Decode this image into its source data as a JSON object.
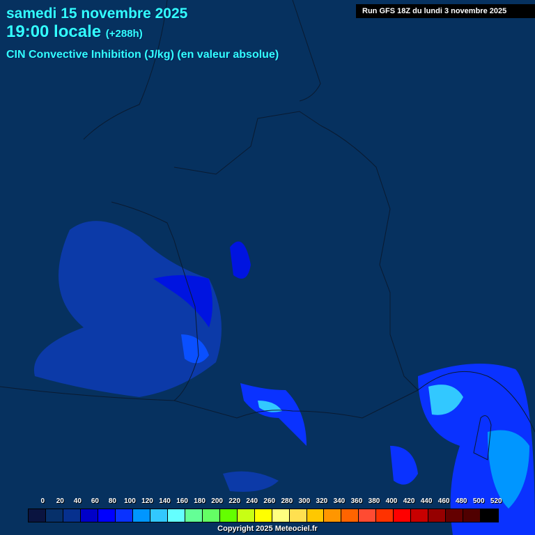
{
  "header": {
    "date": "samedi 15 novembre 2025",
    "time": "19:00 locale",
    "offset": "(+288h)",
    "parameter": "CIN Convective Inhibition (J/kg) (en valeur absolue)",
    "run": "Run GFS 18Z du lundi 3 novembre 2025"
  },
  "legend": {
    "labels": [
      "0",
      "20",
      "40",
      "60",
      "80",
      "100",
      "120",
      "140",
      "160",
      "180",
      "200",
      "220",
      "240",
      "260",
      "280",
      "300",
      "320",
      "340",
      "360",
      "380",
      "400",
      "420",
      "440",
      "460",
      "480",
      "500",
      "520"
    ],
    "colors": [
      "#0a1440",
      "#06306a",
      "#06308e",
      "#0000c8",
      "#0000ff",
      "#0a32ff",
      "#0096ff",
      "#32c8ff",
      "#64ffff",
      "#64ff96",
      "#64ff64",
      "#64ff00",
      "#c8ff14",
      "#ffff00",
      "#ffff80",
      "#ffe050",
      "#ffc800",
      "#ff9600",
      "#ff6400",
      "#ff4b32",
      "#ff3200",
      "#ff0000",
      "#c80000",
      "#960000",
      "#640000",
      "#500000",
      "#000000"
    ]
  },
  "footer": {
    "copyright": "Copyright 2025 Meteociel.fr"
  }
}
